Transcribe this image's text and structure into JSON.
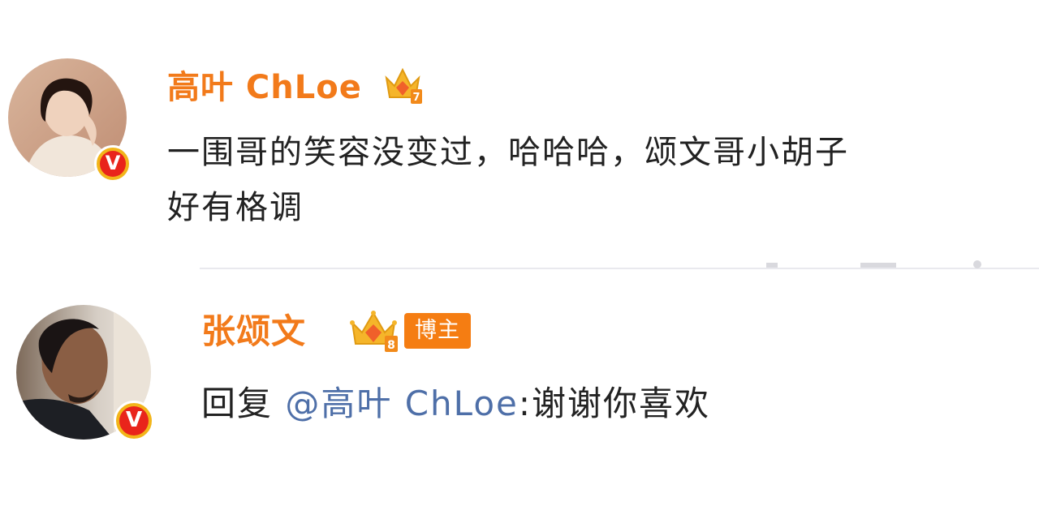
{
  "comment": {
    "username": "高叶 ChLoe",
    "text": "一围哥的笑容没变过，哈哈哈，颂文哥小胡子好有格调",
    "line1": "一围哥的笑容没变过，哈哈哈，颂文哥小胡子",
    "line2": "好有格调",
    "verified_icon": "verified-v-icon",
    "crown_icon": "vip-crown-icon",
    "crown_level": "7"
  },
  "reply": {
    "username": "张颂文",
    "badge_label": "博主",
    "prefix": "回复 ",
    "mention": "@高叶 ChLoe",
    "text": ":谢谢你喜欢",
    "verified_icon": "verified-v-icon",
    "crown_icon": "vip-crown-icon",
    "crown_level": "8"
  },
  "colors": {
    "username": "#f27a1a",
    "mention": "#4e6fa8",
    "text": "#222222",
    "verified_outer": "#f2b51a",
    "verified_inner": "#e9241b",
    "blogger_tag": "#f57d12"
  }
}
